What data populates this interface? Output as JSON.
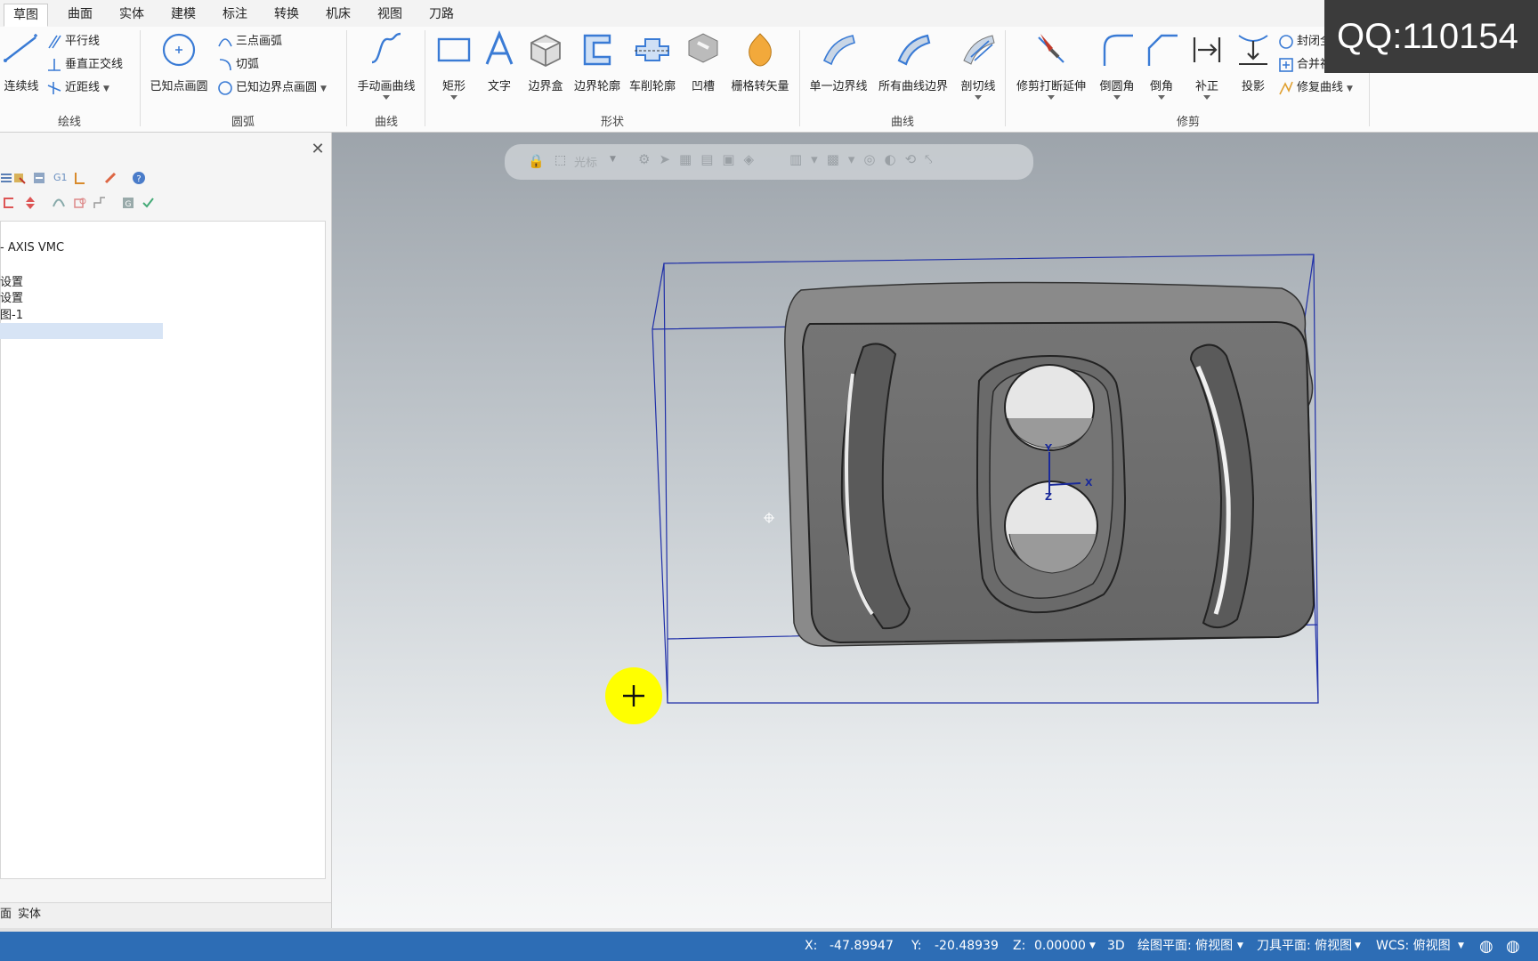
{
  "tabs": [
    "草图",
    "曲面",
    "实体",
    "建模",
    "标注",
    "转换",
    "机床",
    "视图",
    "刀路"
  ],
  "active_tab": "草图",
  "ribbon": {
    "draw_line": {
      "label": "绘线",
      "big": "连续线",
      "small": [
        "平行线",
        "垂直正交线",
        "近距线"
      ]
    },
    "arc": {
      "label": "圆弧",
      "big": "已知点画圆",
      "small": [
        "三点画弧",
        "切弧",
        "已知边界点画圆"
      ]
    },
    "curve": {
      "label": "曲线",
      "big": "手动画曲线"
    },
    "shape": {
      "label": "形状",
      "buttons": [
        "矩形",
        "文字",
        "边界盒",
        "边界轮廓",
        "车削轮廓",
        "凹槽",
        "栅格转矢量"
      ]
    },
    "curve2": {
      "label": "曲线",
      "buttons": [
        "单一边界线",
        "所有曲线边界",
        "剖切线"
      ]
    },
    "trim": {
      "label": "修剪",
      "buttons": [
        "修剪打断延伸",
        "倒圆角",
        "倒角",
        "补正",
        "投影"
      ],
      "small": [
        "封闭全圆",
        "合并视图",
        "修复曲线"
      ]
    }
  },
  "overlay_text": "QQ:110154",
  "panel": {
    "tree": [
      "- AXIS VMC",
      "设置",
      "设置",
      "图-1"
    ],
    "bottom_tabs": [
      "面",
      "实体"
    ]
  },
  "viewport": {
    "selection_hint": "光标",
    "axis_labels": {
      "x": "X",
      "y": "Y",
      "z": "Z"
    }
  },
  "status": {
    "x_label": "X:",
    "x_value": "-47.89947",
    "y_label": "Y:",
    "y_value": "-20.48939",
    "z_label": "Z:",
    "z_value": "0.00000",
    "mode": "3D",
    "plane": "绘图平面: 俯视图",
    "tool_plane": "刀具平面: 俯视图",
    "wcs": "WCS: 俯视图"
  },
  "colors": {
    "status_bar": "#2d6db5",
    "bounding_box": "#1f2fa8",
    "cursor_highlight": "#ffff00",
    "part_surface": "#6f6f6f"
  }
}
